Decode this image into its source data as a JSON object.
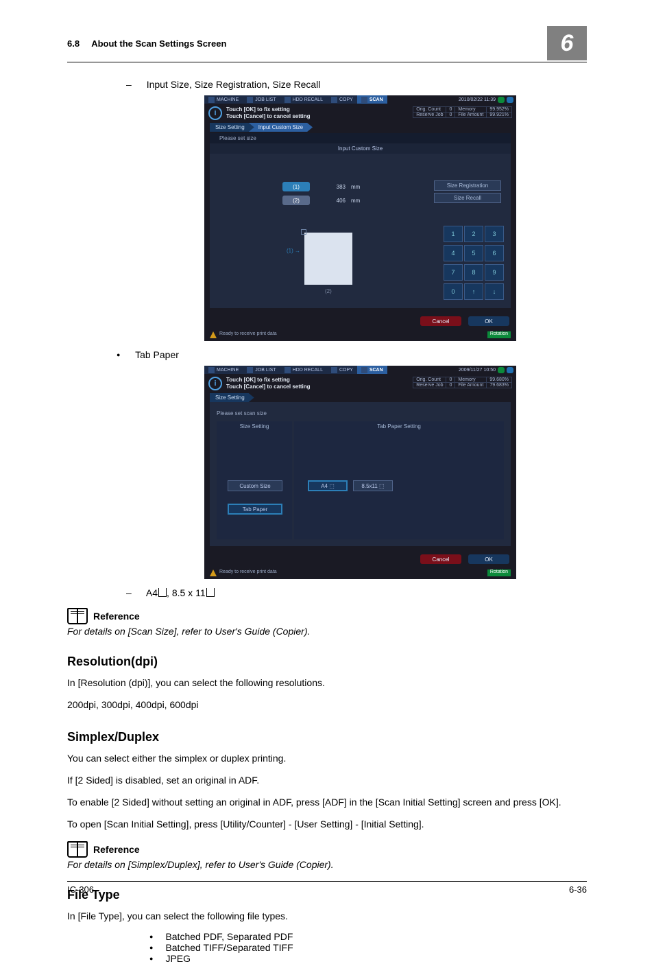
{
  "header": {
    "section_number": "6.8",
    "section_title": "About the Scan Settings Screen",
    "chapter_badge": "6"
  },
  "body": {
    "line1": "Input Size, Size Registration, Size Recall",
    "tab_paper_label": "Tab Paper",
    "sizes_line": "A4⬚, 8.5 x 11⬚",
    "reference1": {
      "label": "Reference",
      "text": "For details on [Scan Size], refer to User's Guide (Copier)."
    },
    "resolution": {
      "heading": "Resolution(dpi)",
      "p1": "In [Resolution (dpi)], you can select the following resolutions.",
      "p2": "200dpi, 300dpi, 400dpi, 600dpi"
    },
    "simplex": {
      "heading": "Simplex/Duplex",
      "p1": "You can select either the simplex or duplex printing.",
      "p2": "If [2 Sided] is disabled, set an original in ADF.",
      "p3": "To enable [2 Sided] without setting an original in ADF, press [ADF] in the [Scan Initial Setting] screen and press [OK].",
      "p4": "To open [Scan Initial Setting], press [Utility/Counter] - [User Setting] - [Initial Setting]."
    },
    "reference2": {
      "label": "Reference",
      "text": "For details on [Simplex/Duplex], refer to User's Guide (Copier)."
    },
    "filetype": {
      "heading": "File Type",
      "p1": "In [File Type], you can select the following file types.",
      "items": [
        "Batched PDF, Separated PDF",
        "Batched TIFF/Separated TIFF",
        "JPEG"
      ]
    }
  },
  "screen1": {
    "tabs": [
      "MACHINE",
      "JOB LIST",
      "HDD RECALL",
      "COPY",
      "SCAN"
    ],
    "timestamp": "2010/02/22 11:39",
    "info1": "Touch [OK] to fix setting",
    "info2": "Touch [Cancel] to cancel setting",
    "info_right": {
      "r1a": "Orig. Count",
      "r1b": "0",
      "r1c": "Memory",
      "r1d": "99.952%",
      "r2a": "Reserve Job",
      "r2b": "0",
      "r2c": "File Amount",
      "r2d": "99.921%"
    },
    "crumb1": "Size Setting",
    "crumb2": "Input Custom Size",
    "hint": "Please set size",
    "title": "Input Custom Size",
    "x_lbl": "(1)",
    "x_val": "383",
    "x_unit": "mm",
    "y_lbl": "(2)",
    "y_val": "406",
    "y_unit": "mm",
    "preview_x": "(1)",
    "preview_y": "(2)",
    "btn_reg": "Size Registration",
    "btn_recall": "Size Recall",
    "keys": [
      "1",
      "2",
      "3",
      "4",
      "5",
      "6",
      "7",
      "8",
      "9",
      "0",
      "↑",
      "↓"
    ],
    "cancel": "Cancel",
    "ok": "OK",
    "status": "Ready to receive print data",
    "rotation": "Rotation"
  },
  "screen2": {
    "tabs": [
      "MACHINE",
      "JOB LIST",
      "HDD RECALL",
      "COPY",
      "SCAN"
    ],
    "timestamp": "2009/11/27 10:50",
    "info1": "Touch [OK] to fix setting",
    "info2": "Touch [Cancel] to cancel setting",
    "info_right": {
      "r1a": "Orig. Count",
      "r1b": "0",
      "r1c": "Memory",
      "r1d": "99.680%",
      "r2a": "Reserve Job",
      "r2b": "0",
      "r2c": "File Amount",
      "r2d": "79.683%"
    },
    "crumb1": "Size Setting",
    "hint": "Please set scan size",
    "col1_head": "Size Setting",
    "col2_head": "Tab Paper Setting",
    "btn_custom": "Custom Size",
    "btn_tab": "Tab Paper",
    "btn_a4": "A4 ⬚",
    "btn_85": "8.5x11 ⬚",
    "cancel": "Cancel",
    "ok": "OK",
    "status": "Ready to receive print data",
    "rotation": "Rotation"
  },
  "footer": {
    "left": "IC-306",
    "right": "6-36"
  }
}
